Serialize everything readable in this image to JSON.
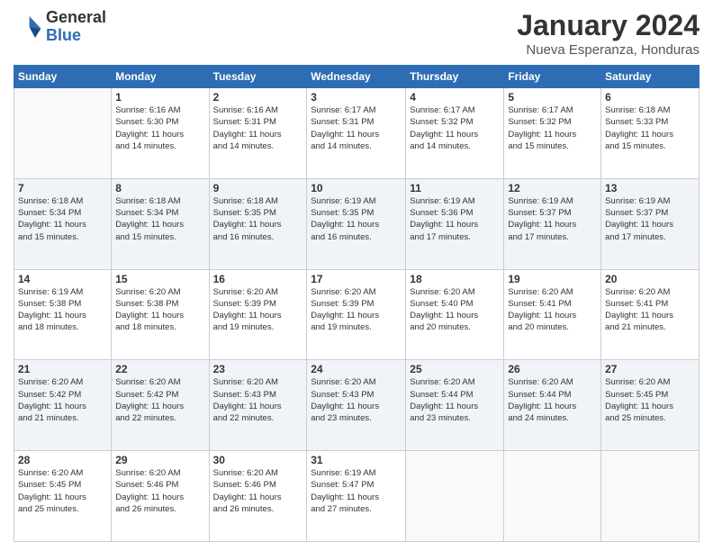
{
  "header": {
    "logo_line1": "General",
    "logo_line2": "Blue",
    "month_year": "January 2024",
    "location": "Nueva Esperanza, Honduras"
  },
  "days_of_week": [
    "Sunday",
    "Monday",
    "Tuesday",
    "Wednesday",
    "Thursday",
    "Friday",
    "Saturday"
  ],
  "weeks": [
    [
      {
        "day": "",
        "info": ""
      },
      {
        "day": "1",
        "info": "Sunrise: 6:16 AM\nSunset: 5:30 PM\nDaylight: 11 hours\nand 14 minutes."
      },
      {
        "day": "2",
        "info": "Sunrise: 6:16 AM\nSunset: 5:31 PM\nDaylight: 11 hours\nand 14 minutes."
      },
      {
        "day": "3",
        "info": "Sunrise: 6:17 AM\nSunset: 5:31 PM\nDaylight: 11 hours\nand 14 minutes."
      },
      {
        "day": "4",
        "info": "Sunrise: 6:17 AM\nSunset: 5:32 PM\nDaylight: 11 hours\nand 14 minutes."
      },
      {
        "day": "5",
        "info": "Sunrise: 6:17 AM\nSunset: 5:32 PM\nDaylight: 11 hours\nand 15 minutes."
      },
      {
        "day": "6",
        "info": "Sunrise: 6:18 AM\nSunset: 5:33 PM\nDaylight: 11 hours\nand 15 minutes."
      }
    ],
    [
      {
        "day": "7",
        "info": "Sunrise: 6:18 AM\nSunset: 5:34 PM\nDaylight: 11 hours\nand 15 minutes."
      },
      {
        "day": "8",
        "info": "Sunrise: 6:18 AM\nSunset: 5:34 PM\nDaylight: 11 hours\nand 15 minutes."
      },
      {
        "day": "9",
        "info": "Sunrise: 6:18 AM\nSunset: 5:35 PM\nDaylight: 11 hours\nand 16 minutes."
      },
      {
        "day": "10",
        "info": "Sunrise: 6:19 AM\nSunset: 5:35 PM\nDaylight: 11 hours\nand 16 minutes."
      },
      {
        "day": "11",
        "info": "Sunrise: 6:19 AM\nSunset: 5:36 PM\nDaylight: 11 hours\nand 17 minutes."
      },
      {
        "day": "12",
        "info": "Sunrise: 6:19 AM\nSunset: 5:37 PM\nDaylight: 11 hours\nand 17 minutes."
      },
      {
        "day": "13",
        "info": "Sunrise: 6:19 AM\nSunset: 5:37 PM\nDaylight: 11 hours\nand 17 minutes."
      }
    ],
    [
      {
        "day": "14",
        "info": "Sunrise: 6:19 AM\nSunset: 5:38 PM\nDaylight: 11 hours\nand 18 minutes."
      },
      {
        "day": "15",
        "info": "Sunrise: 6:20 AM\nSunset: 5:38 PM\nDaylight: 11 hours\nand 18 minutes."
      },
      {
        "day": "16",
        "info": "Sunrise: 6:20 AM\nSunset: 5:39 PM\nDaylight: 11 hours\nand 19 minutes."
      },
      {
        "day": "17",
        "info": "Sunrise: 6:20 AM\nSunset: 5:39 PM\nDaylight: 11 hours\nand 19 minutes."
      },
      {
        "day": "18",
        "info": "Sunrise: 6:20 AM\nSunset: 5:40 PM\nDaylight: 11 hours\nand 20 minutes."
      },
      {
        "day": "19",
        "info": "Sunrise: 6:20 AM\nSunset: 5:41 PM\nDaylight: 11 hours\nand 20 minutes."
      },
      {
        "day": "20",
        "info": "Sunrise: 6:20 AM\nSunset: 5:41 PM\nDaylight: 11 hours\nand 21 minutes."
      }
    ],
    [
      {
        "day": "21",
        "info": "Sunrise: 6:20 AM\nSunset: 5:42 PM\nDaylight: 11 hours\nand 21 minutes."
      },
      {
        "day": "22",
        "info": "Sunrise: 6:20 AM\nSunset: 5:42 PM\nDaylight: 11 hours\nand 22 minutes."
      },
      {
        "day": "23",
        "info": "Sunrise: 6:20 AM\nSunset: 5:43 PM\nDaylight: 11 hours\nand 22 minutes."
      },
      {
        "day": "24",
        "info": "Sunrise: 6:20 AM\nSunset: 5:43 PM\nDaylight: 11 hours\nand 23 minutes."
      },
      {
        "day": "25",
        "info": "Sunrise: 6:20 AM\nSunset: 5:44 PM\nDaylight: 11 hours\nand 23 minutes."
      },
      {
        "day": "26",
        "info": "Sunrise: 6:20 AM\nSunset: 5:44 PM\nDaylight: 11 hours\nand 24 minutes."
      },
      {
        "day": "27",
        "info": "Sunrise: 6:20 AM\nSunset: 5:45 PM\nDaylight: 11 hours\nand 25 minutes."
      }
    ],
    [
      {
        "day": "28",
        "info": "Sunrise: 6:20 AM\nSunset: 5:45 PM\nDaylight: 11 hours\nand 25 minutes."
      },
      {
        "day": "29",
        "info": "Sunrise: 6:20 AM\nSunset: 5:46 PM\nDaylight: 11 hours\nand 26 minutes."
      },
      {
        "day": "30",
        "info": "Sunrise: 6:20 AM\nSunset: 5:46 PM\nDaylight: 11 hours\nand 26 minutes."
      },
      {
        "day": "31",
        "info": "Sunrise: 6:19 AM\nSunset: 5:47 PM\nDaylight: 11 hours\nand 27 minutes."
      },
      {
        "day": "",
        "info": ""
      },
      {
        "day": "",
        "info": ""
      },
      {
        "day": "",
        "info": ""
      }
    ]
  ]
}
